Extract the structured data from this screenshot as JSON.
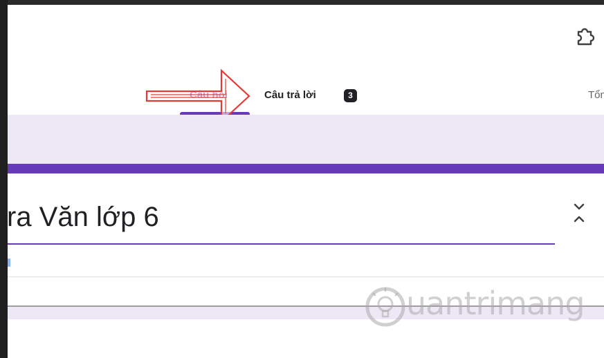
{
  "tabs": {
    "questions_label": "Câu hỏi",
    "responses_label": "Câu trả lời",
    "responses_count": "3",
    "settings_label": "Tổng",
    "active": "questions"
  },
  "form": {
    "title": "ra Văn lớp 6"
  },
  "icons": {
    "addon": "puzzle-piece-icon",
    "collapse": "unfold-less-icon",
    "annotation": "red-outline-arrow-right",
    "watermark_logo": "lightbulb-logo"
  },
  "watermark": {
    "text": "uantrimang"
  },
  "colors": {
    "accent": "#673ab7",
    "header_background": "#ede7f6",
    "annotation_arrow": "#e53935"
  }
}
